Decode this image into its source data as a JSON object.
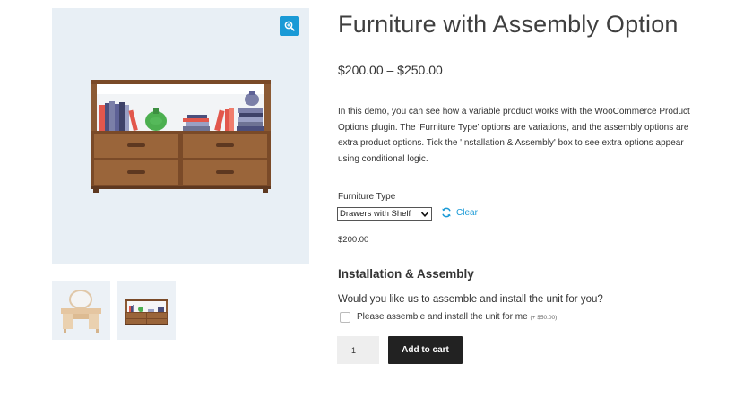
{
  "product": {
    "title": "Furniture with Assembly Option",
    "price_range": "$200.00 – $250.00",
    "description": "In this demo, you can see how a variable product works with the WooCommerce Product Options plugin. The 'Furniture Type' options are variations, and the assembly options are extra product options. Tick the 'Installation & Assembly' box to see extra options appear using conditional logic."
  },
  "variation": {
    "label": "Furniture Type",
    "selected": "Drawers with Shelf",
    "clear_label": "Clear",
    "price": "$200.00"
  },
  "assembly": {
    "section_title": "Installation & Assembly",
    "question": "Would you like us to assemble and install the unit for you?",
    "checkbox_label": "Please assemble and install the unit for me",
    "checkbox_extra": "(+ $50.00)",
    "checked": false
  },
  "cart": {
    "quantity": "1",
    "add_to_cart_label": "Add to cart"
  },
  "icons": {
    "zoom": "magnifier-plus-icon",
    "clear": "refresh-icon",
    "select": "chevron-down-icon"
  },
  "colors": {
    "accent": "#1a9ad6",
    "button": "#222222",
    "image_bg": "#e8eff5",
    "wood": "#8b5a34"
  }
}
